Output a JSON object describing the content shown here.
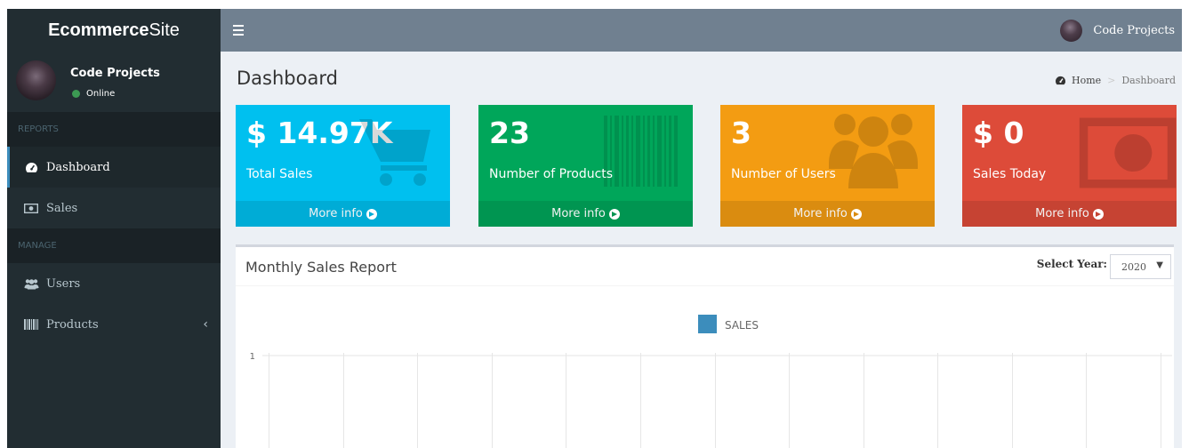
{
  "header": {
    "logo_bold": "Ecommerce",
    "logo_rest": "Site",
    "user_name": "Code Projects"
  },
  "sidebar": {
    "user": {
      "name": "Code Projects",
      "status": "Online"
    },
    "sections": [
      {
        "title": "REPORTS"
      },
      {
        "title": "MANAGE"
      }
    ],
    "items": [
      {
        "label": "Dashboard",
        "icon": "dashboard-icon",
        "active": true
      },
      {
        "label": "Sales",
        "icon": "money-icon"
      },
      {
        "label": "Users",
        "icon": "users-icon"
      },
      {
        "label": "Products",
        "icon": "barcode-icon",
        "has_submenu": true
      }
    ]
  },
  "content": {
    "title": "Dashboard",
    "breadcrumb": {
      "home": "Home",
      "current": "Dashboard"
    }
  },
  "stats": [
    {
      "value": "$ 14.97K",
      "label": "Total Sales",
      "link": "More info",
      "icon": "shopping-cart-icon",
      "color": "#00c0ef",
      "footer_color": "#00acd6"
    },
    {
      "value": "23",
      "label": "Number of Products",
      "link": "More info",
      "icon": "barcode-icon",
      "color": "#00a65a",
      "footer_color": "#009551"
    },
    {
      "value": "3",
      "label": "Number of Users",
      "link": "More info",
      "icon": "users-icon",
      "color": "#f39c12",
      "footer_color": "#da8c10"
    },
    {
      "value": "$ 0",
      "label": "Sales Today",
      "link": "More info",
      "icon": "money-icon",
      "color": "#dd4b39",
      "footer_color": "#c64333"
    }
  ],
  "report": {
    "title": "Monthly Sales Report",
    "year_label": "Select Year:",
    "year_value": "2020"
  },
  "chart_data": {
    "type": "bar",
    "categories": [],
    "series": [
      {
        "name": "SALES",
        "values": [],
        "color": "#3c8dbc"
      }
    ],
    "ytick_labels": [
      "1"
    ],
    "legend": "top-center",
    "grid": true
  }
}
